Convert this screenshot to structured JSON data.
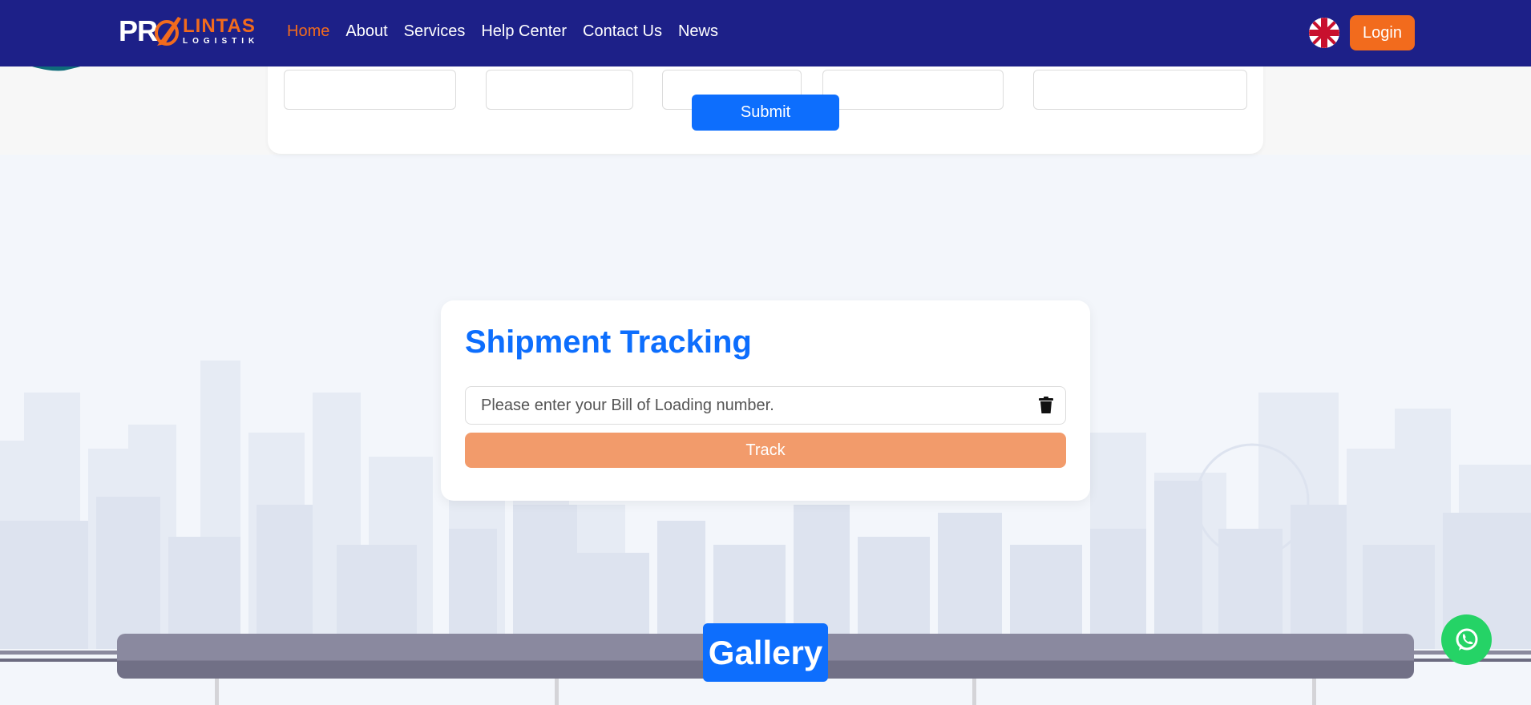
{
  "header": {
    "logo": {
      "pro": "PR",
      "lintas": "LINTAS",
      "logistik": "LOGISTIK"
    },
    "nav": [
      {
        "label": "Home",
        "active": true
      },
      {
        "label": "About",
        "active": false
      },
      {
        "label": "Services",
        "active": false
      },
      {
        "label": "Help Center",
        "active": false
      },
      {
        "label": "Contact Us",
        "active": false
      },
      {
        "label": "News",
        "active": false
      }
    ],
    "language_icon": "uk-flag-icon",
    "login_label": "Login"
  },
  "form": {
    "submit_label": "Submit"
  },
  "tracking": {
    "title": "Shipment Tracking",
    "placeholder": "Please enter your Bill of Loading number.",
    "value": "",
    "clear_icon": "trash-icon",
    "track_label": "Track"
  },
  "gallery": {
    "title": "Gallery"
  },
  "floating": {
    "whatsapp_icon": "whatsapp-icon"
  },
  "colors": {
    "navy": "#1d2088",
    "orange": "#f26b1d",
    "blue": "#0d6efd",
    "track_button": "#f29b6b",
    "whatsapp": "#25d366"
  }
}
